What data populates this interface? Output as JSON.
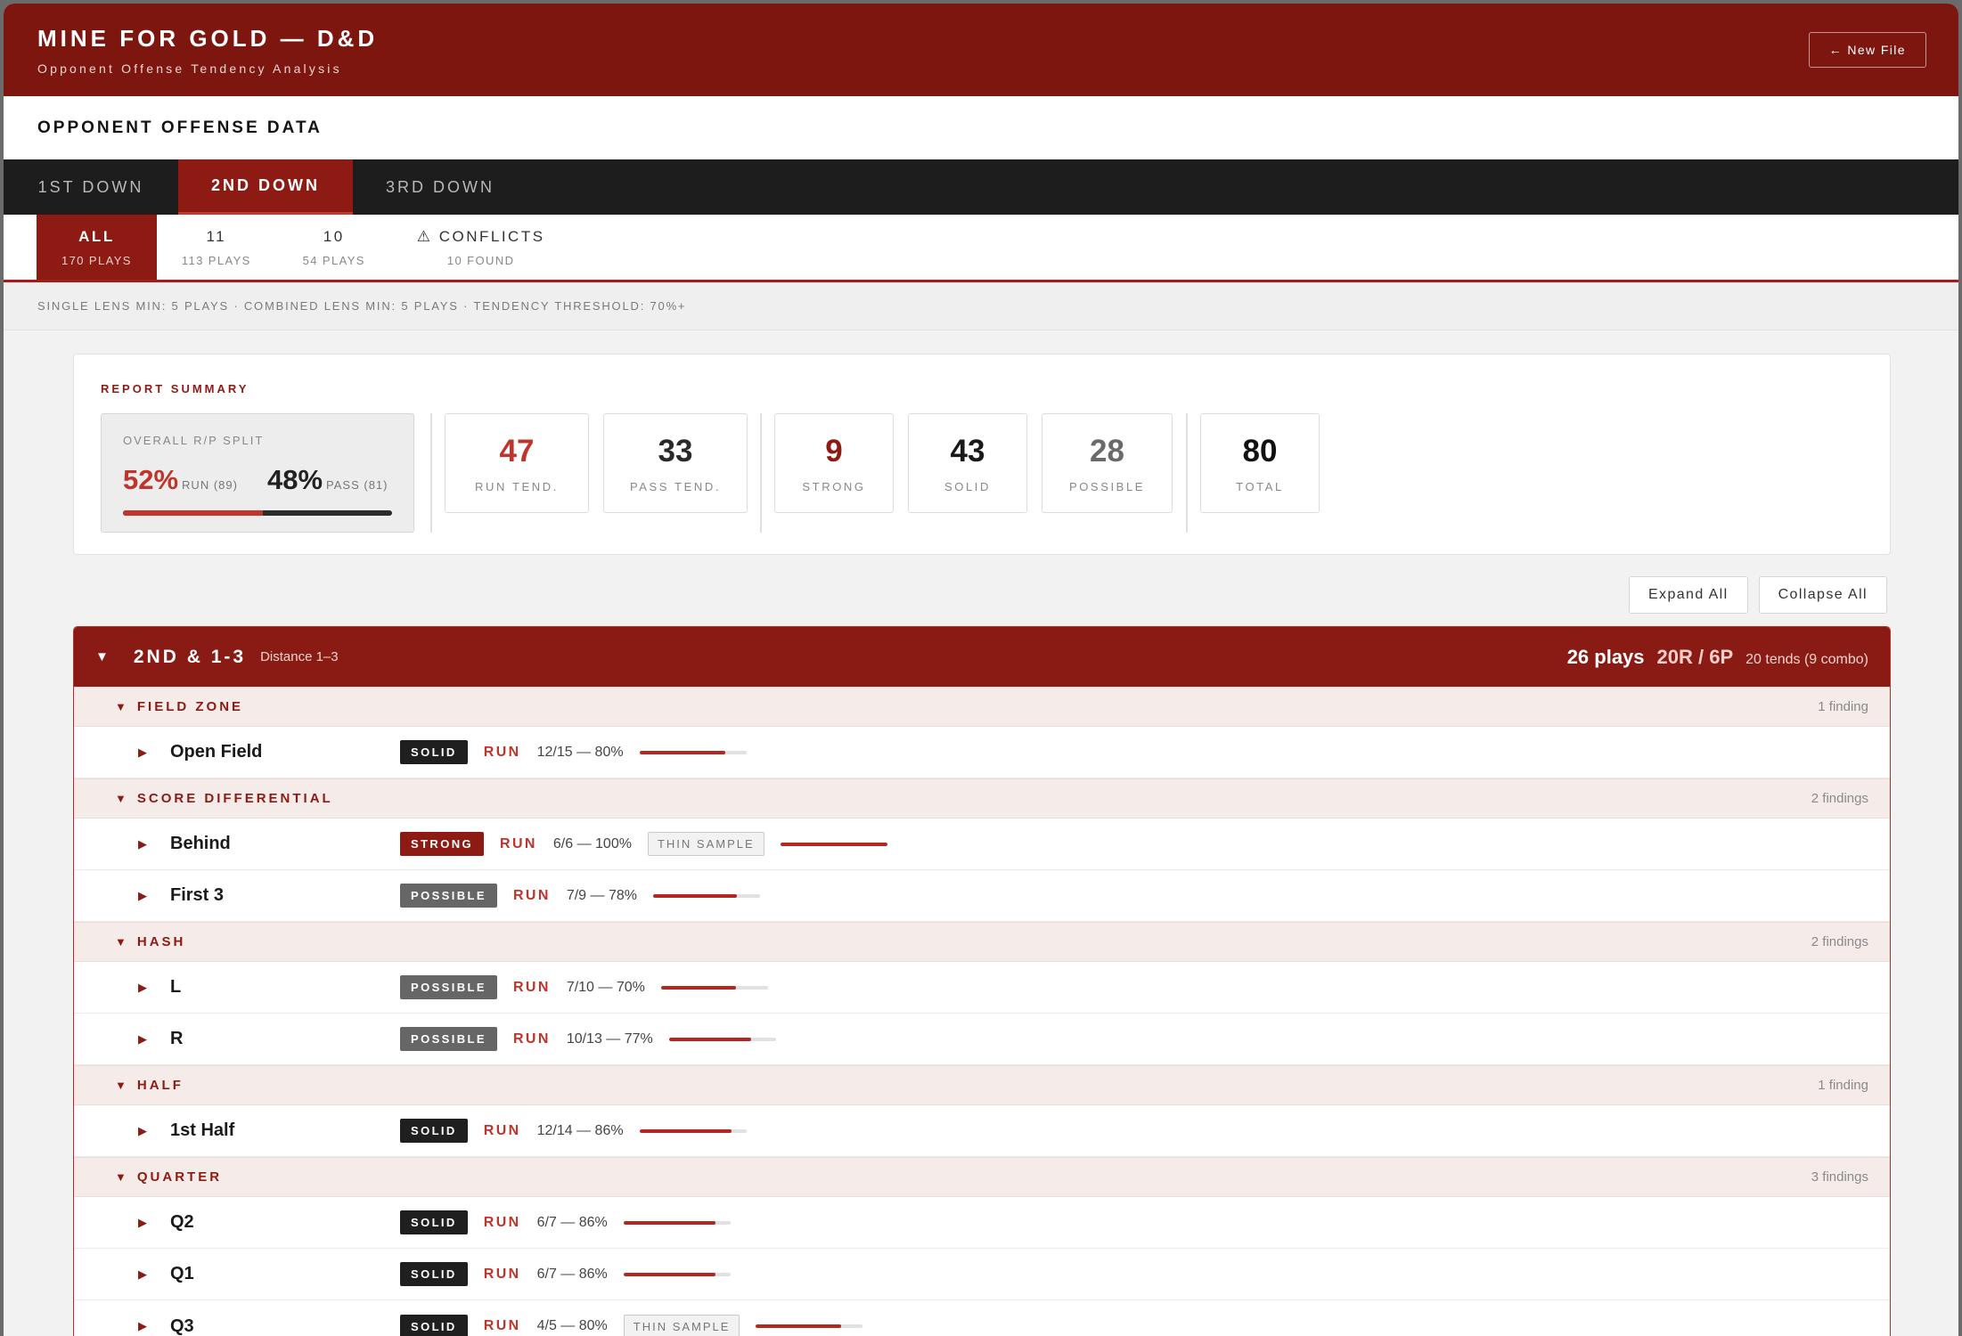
{
  "header": {
    "title": "MINE FOR GOLD — D&D",
    "subtitle": "Opponent Offense Tendency Analysis",
    "new_file_label": "← New File"
  },
  "section_title": "OPPONENT OFFENSE DATA",
  "down_tabs": [
    {
      "label": "1ST DOWN",
      "active": false
    },
    {
      "label": "2ND DOWN",
      "active": true
    },
    {
      "label": "3RD DOWN",
      "active": false
    }
  ],
  "personnel_tabs": [
    {
      "label": "ALL",
      "sub": "170 PLAYS",
      "active": true
    },
    {
      "label": "11",
      "sub": "113 PLAYS",
      "active": false
    },
    {
      "label": "10",
      "sub": "54 PLAYS",
      "active": false
    },
    {
      "label": "⚠ CONFLICTS",
      "sub": "10 FOUND",
      "active": false
    }
  ],
  "thresholds": "SINGLE LENS MIN: 5 PLAYS · COMBINED LENS MIN: 5 PLAYS · TENDENCY THRESHOLD: 70%+",
  "summary": {
    "label": "REPORT SUMMARY",
    "rp_label": "OVERALL R/P SPLIT",
    "run_pct": "52%",
    "run_note": "RUN (89)",
    "pass_pct": "48%",
    "pass_note": "PASS (81)",
    "run_fraction": 0.52,
    "stats": [
      {
        "value": "47",
        "label": "RUN TEND.",
        "color": "#c0342b"
      },
      {
        "value": "33",
        "label": "PASS TEND.",
        "color": "#2a2a2a"
      },
      {
        "value": "9",
        "label": "STRONG",
        "color": "#8d1b14"
      },
      {
        "value": "43",
        "label": "SOLID",
        "color": "#1a1a1a"
      },
      {
        "value": "28",
        "label": "POSSIBLE",
        "color": "#6a6a6a"
      },
      {
        "value": "80",
        "label": "TOTAL",
        "color": "#111111"
      }
    ]
  },
  "controls": {
    "expand_all": "Expand All",
    "collapse_all": "Collapse All"
  },
  "group": {
    "caret": "▼",
    "title": "2ND & 1-3",
    "distance": "Distance 1–3",
    "plays": "26 plays",
    "split": "20R / 6P",
    "tends": "20 tends (9 combo)",
    "categories": [
      {
        "title": "FIELD ZONE",
        "count": "1 finding",
        "findings": [
          {
            "name": "Open Field",
            "badge": "SOLID",
            "direction": "RUN",
            "stat": "12/15 — 80%",
            "thin": "",
            "fraction": 0.8
          }
        ]
      },
      {
        "title": "SCORE DIFFERENTIAL",
        "count": "2 findings",
        "findings": [
          {
            "name": "Behind",
            "badge": "STRONG",
            "direction": "RUN",
            "stat": "6/6 — 100%",
            "thin": "THIN SAMPLE",
            "fraction": 1.0
          },
          {
            "name": "First 3",
            "badge": "POSSIBLE",
            "direction": "RUN",
            "stat": "7/9 — 78%",
            "thin": "",
            "fraction": 0.78
          }
        ]
      },
      {
        "title": "HASH",
        "count": "2 findings",
        "findings": [
          {
            "name": "L",
            "badge": "POSSIBLE",
            "direction": "RUN",
            "stat": "7/10 — 70%",
            "thin": "",
            "fraction": 0.7
          },
          {
            "name": "R",
            "badge": "POSSIBLE",
            "direction": "RUN",
            "stat": "10/13 — 77%",
            "thin": "",
            "fraction": 0.77
          }
        ]
      },
      {
        "title": "HALF",
        "count": "1 finding",
        "findings": [
          {
            "name": "1st Half",
            "badge": "SOLID",
            "direction": "RUN",
            "stat": "12/14 — 86%",
            "thin": "",
            "fraction": 0.86
          }
        ]
      },
      {
        "title": "QUARTER",
        "count": "3 findings",
        "findings": [
          {
            "name": "Q2",
            "badge": "SOLID",
            "direction": "RUN",
            "stat": "6/7 — 86%",
            "thin": "",
            "fraction": 0.86
          },
          {
            "name": "Q1",
            "badge": "SOLID",
            "direction": "RUN",
            "stat": "6/7 — 86%",
            "thin": "",
            "fraction": 0.86
          },
          {
            "name": "Q3",
            "badge": "SOLID",
            "direction": "RUN",
            "stat": "4/5 — 80%",
            "thin": "THIN SAMPLE",
            "fraction": 0.8
          }
        ]
      }
    ]
  }
}
